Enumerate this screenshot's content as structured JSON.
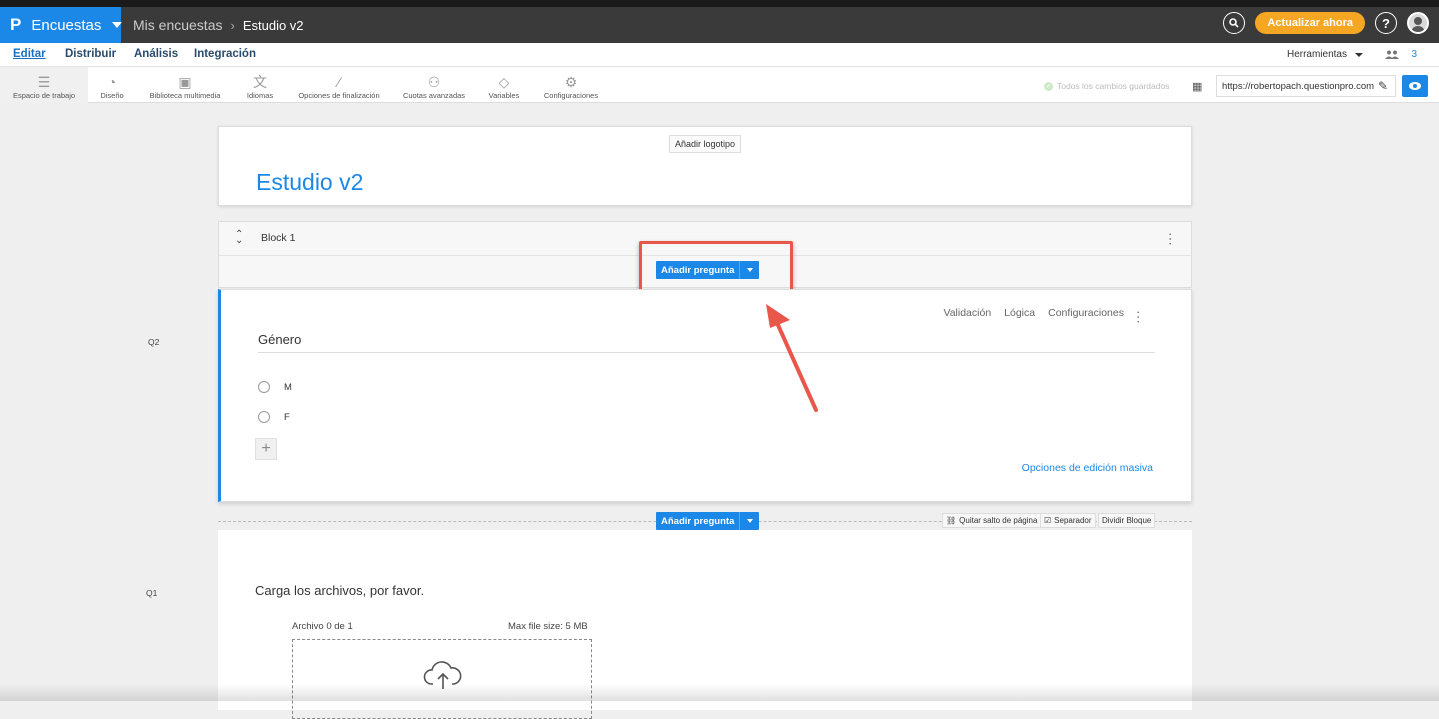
{
  "app": {
    "logo_letter": "P",
    "name": "Encuestas"
  },
  "breadcrumb": {
    "parent": "Mis encuestas",
    "separator": "›",
    "current": "Estudio v2"
  },
  "topbar": {
    "upgrade_label": "Actualizar ahora",
    "help_label": "?"
  },
  "nav": {
    "tabs": [
      "Editar",
      "Distribuir",
      "Análisis",
      "Integración"
    ],
    "tools_label": "Herramientas",
    "users_count": "3"
  },
  "toolbar": {
    "items": [
      {
        "label": "Espacio de trabajo",
        "icon": "workspace-icon"
      },
      {
        "label": "Diseño",
        "icon": "palette-icon"
      },
      {
        "label": "Biblioteca multimedia",
        "icon": "image-icon"
      },
      {
        "label": "Idiomas",
        "icon": "language-icon"
      },
      {
        "label": "Opciones de finalización",
        "icon": "wand-icon"
      },
      {
        "label": "Cuotas avanzadas",
        "icon": "quota-icon"
      },
      {
        "label": "Variables",
        "icon": "tag-icon"
      },
      {
        "label": "Configuraciones",
        "icon": "gear-icon"
      }
    ],
    "saved_status": "Todos los cambios guardados",
    "survey_url": "https://robertopach.questionpro.com"
  },
  "survey": {
    "add_logo_label": "Añadir logotipo",
    "title": "Estudio v2",
    "block_name": "Block 1",
    "add_question_label": "Añadir pregunta"
  },
  "q2": {
    "number": "Q2",
    "menu": [
      "Validación",
      "Lógica",
      "Configuraciones"
    ],
    "text": "Género",
    "options": [
      "M",
      "F"
    ],
    "bulk_edit_label": "Opciones de edición masiva"
  },
  "page_controls": {
    "remove_page_break": "Quitar salto de página",
    "separator": "Separador",
    "split_block": "Dividir Bloque"
  },
  "q1": {
    "number": "Q1",
    "text": "Carga los archivos, por favor.",
    "file_count": "Archivo 0 de 1",
    "max_size": "Max file size: 5 MB"
  },
  "colors": {
    "accent": "#1b87e6",
    "highlight": "#e9564a",
    "upgrade": "#f5a623"
  }
}
